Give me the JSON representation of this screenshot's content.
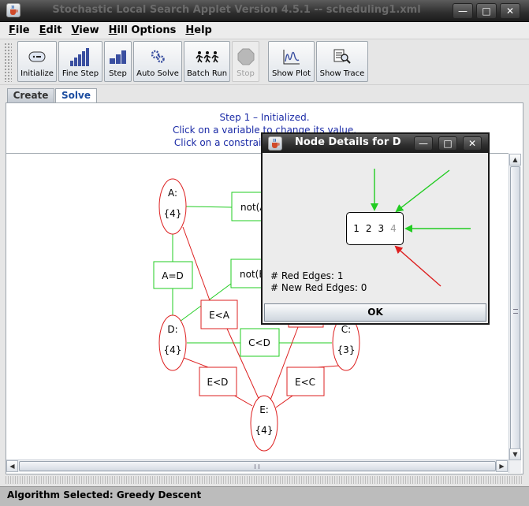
{
  "window": {
    "title": "Stochastic Local Search Applet Version 4.5.1 -- scheduling1.xml",
    "controls": {
      "minimize": "—",
      "maximize": "□",
      "close": "✕"
    }
  },
  "menubar": [
    {
      "key": "F",
      "rest": "ile"
    },
    {
      "key": "E",
      "rest": "dit"
    },
    {
      "key": "V",
      "rest": "iew"
    },
    {
      "key": "H",
      "rest": "ill Options"
    },
    {
      "key": "H",
      "rest": "elp"
    }
  ],
  "toolbar": {
    "initialize": "Initialize",
    "fine_step": "Fine Step",
    "step": "Step",
    "auto_solve": "Auto Solve",
    "batch_run": "Batch Run",
    "stop": "Stop",
    "show_plot": "Show Plot",
    "show_trace": "Show Trace"
  },
  "tabs": {
    "create": "Create",
    "solve": "Solve",
    "selected": "Solve"
  },
  "messages": [
    "Step 1 – Initialized.",
    "Click on a variable to change its value.",
    "Click on a constraint to see its details."
  ],
  "graph": {
    "variables": [
      {
        "name": "A:",
        "domain": "{4}"
      },
      {
        "name": "D:",
        "domain": "{4}"
      },
      {
        "name": "C:",
        "domain": "{3}"
      },
      {
        "name": "E:",
        "domain": "{4}"
      }
    ],
    "constraints": {
      "notA": "not(A",
      "a_eq_d": "A=D",
      "notB": "not(B",
      "e_lt_a": "E<A",
      "c_lt_d": "C<D",
      "e_lt_d": "E<D",
      "e_lt_c": "E<C"
    },
    "colors": {
      "consistent": "#22cc22",
      "inconsistent": "#dd2020"
    }
  },
  "dialog": {
    "title": "Node Details for D",
    "domain_values": [
      "1",
      "2",
      "3",
      "4"
    ],
    "current_value": "4",
    "red_edges_label": "# Red Edges:",
    "red_edges": "1",
    "new_red_edges_label": "# New Red Edges:",
    "new_red_edges": "0",
    "ok_label": "OK"
  },
  "status": {
    "label": "Algorithm Selected:",
    "value": "Greedy Descent"
  }
}
